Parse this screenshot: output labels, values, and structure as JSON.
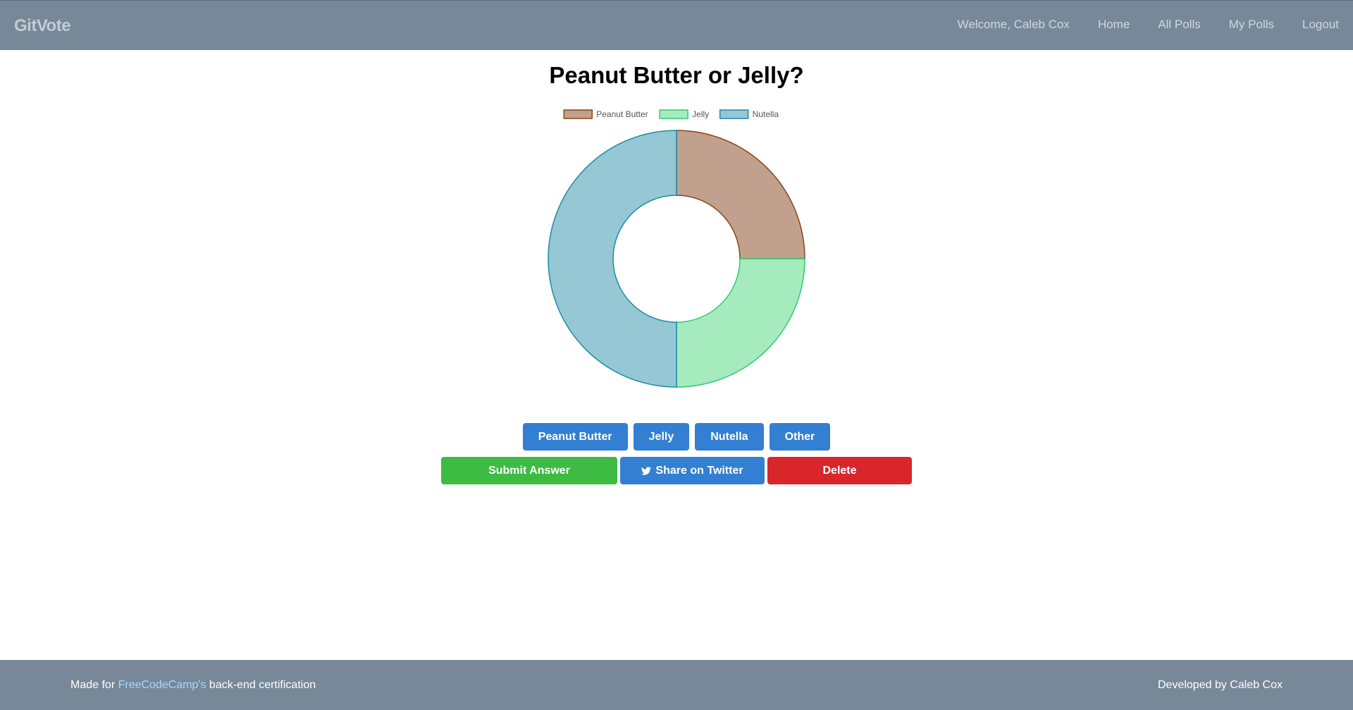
{
  "navbar": {
    "brand": "GitVote",
    "welcome": "Welcome, Caleb Cox",
    "links": [
      "Home",
      "All Polls",
      "My Polls",
      "Logout"
    ]
  },
  "poll": {
    "title": "Peanut Butter or Jelly?",
    "options": [
      "Peanut Butter",
      "Jelly",
      "Nutella",
      "Other"
    ]
  },
  "actions": {
    "submit": "Submit Answer",
    "share": "Share on Twitter",
    "delete": "Delete"
  },
  "chart_data": {
    "type": "pie",
    "categories": [
      "Peanut Butter",
      "Jelly",
      "Nutella"
    ],
    "values": [
      1,
      1,
      2
    ],
    "colors": {
      "fill": [
        "#c1a08d",
        "#a5ebbe",
        "#95c7d4"
      ],
      "stroke": [
        "#8b4513",
        "#2ecc71",
        "#1b8aaa"
      ]
    },
    "legend": "top",
    "title": ""
  },
  "footer": {
    "left_prefix": "Made for ",
    "left_link": "FreeCodeCamp's",
    "left_suffix": " back-end certification",
    "right": "Developed by Caleb Cox"
  },
  "colors": {
    "navbar": "#778899",
    "primary": "#337fd1",
    "success": "#3dbb42",
    "danger": "#d8262b"
  },
  "icons": {
    "share": "twitter-icon"
  }
}
